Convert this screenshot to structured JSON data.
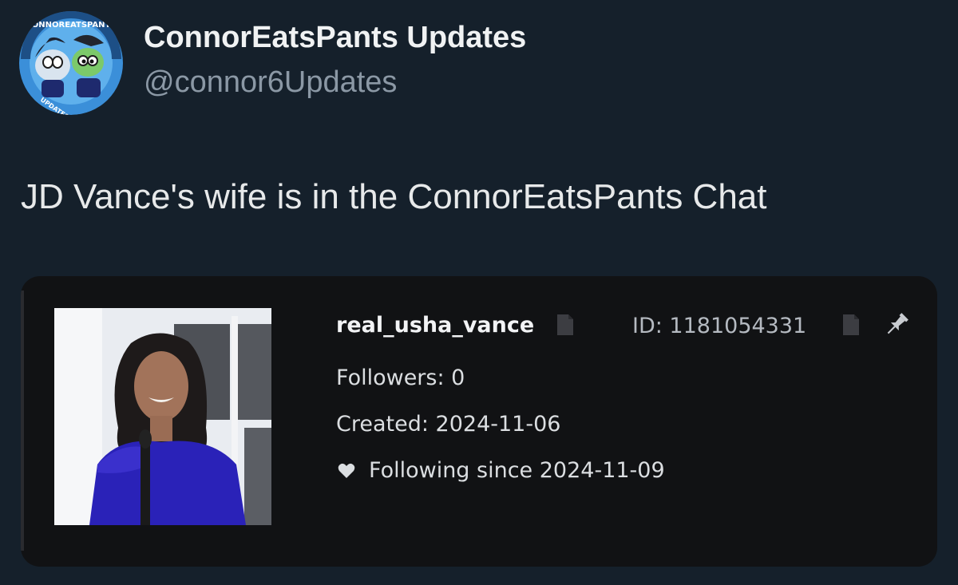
{
  "author": {
    "display_name": "ConnorEatsPants Updates",
    "handle": "@connor6Updates",
    "avatar_ring_text": "CONNOREATSPANTS",
    "avatar_bottom_text": "UPDATES"
  },
  "tweet": {
    "text": "JD Vance's wife is in the ConnorEatsPants Chat"
  },
  "embed": {
    "username": "real_usha_vance",
    "user_id": "ID: 1181054331",
    "followers": "Followers: 0",
    "created": "Created: 2024-11-06",
    "following_since": "Following since 2024-11-09",
    "icons": [
      "copy-icon",
      "copy-icon",
      "pin-icon",
      "heart-icon"
    ]
  },
  "colors": {
    "background": "#15202b",
    "embed_background": "#111214",
    "handle": "#8b98a5",
    "dress": "#2a22b8"
  }
}
